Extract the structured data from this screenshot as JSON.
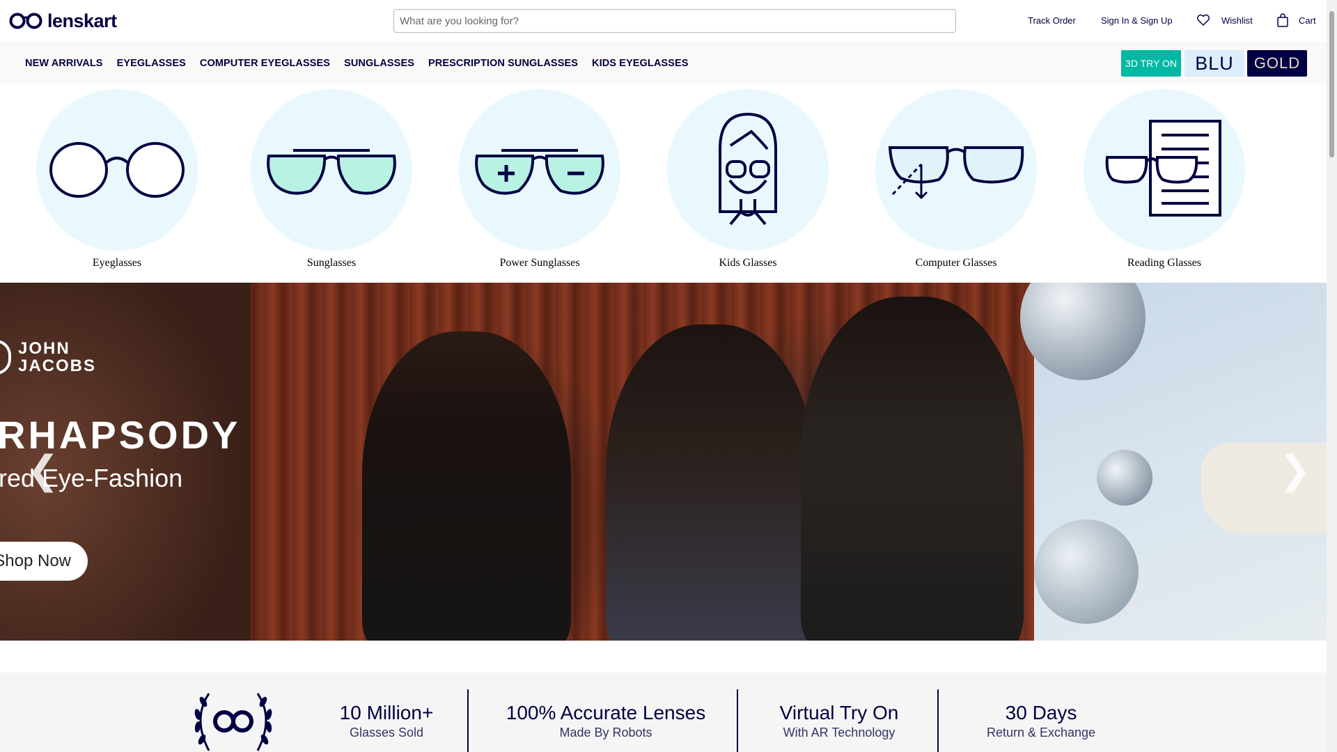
{
  "header": {
    "brand": "lenskart",
    "search_placeholder": "What are you looking for?",
    "track_order": "Track Order",
    "sign_in": "Sign In & Sign Up",
    "wishlist": "Wishlist",
    "cart": "Cart"
  },
  "nav": {
    "items": [
      "NEW ARRIVALS",
      "EYEGLASSES",
      "COMPUTER EYEGLASSES",
      "SUNGLASSES",
      "PRESCRIPTION SUNGLASSES",
      "KIDS EYEGLASSES"
    ],
    "try_on": "3D TRY ON",
    "blu": "BLU",
    "gold": "GOLD"
  },
  "categories": [
    {
      "label": "Eyeglasses",
      "icon": "eyeglasses-icon"
    },
    {
      "label": "Sunglasses",
      "icon": "sunglasses-icon"
    },
    {
      "label": "Power Sunglasses",
      "icon": "power-sunglasses-icon"
    },
    {
      "label": "Kids Glasses",
      "icon": "kids-glasses-icon"
    },
    {
      "label": "Computer Glasses",
      "icon": "computer-glasses-icon"
    },
    {
      "label": "Reading Glasses",
      "icon": "reading-glasses-icon"
    }
  ],
  "banner": {
    "brand_line1": "JOHN",
    "brand_line2": "JACOBS",
    "headline": "RHAPSODY",
    "subline": "red Eye-Fashion",
    "cta": "Shop Now",
    "prev": "❮",
    "next": "❯"
  },
  "stats": [
    {
      "big": "10 Million+",
      "small": "Glasses Sold"
    },
    {
      "big": "100% Accurate Lenses",
      "small": "Made By Robots"
    },
    {
      "big": "Virtual Try On",
      "small": "With AR Technology"
    },
    {
      "big": "30 Days",
      "small": "Return & Exchange"
    }
  ],
  "colors": {
    "navy": "#000042",
    "teal": "#00b9a5",
    "icon_bg": "#e9f8fc",
    "lens_fill": "#b8f2e2"
  }
}
